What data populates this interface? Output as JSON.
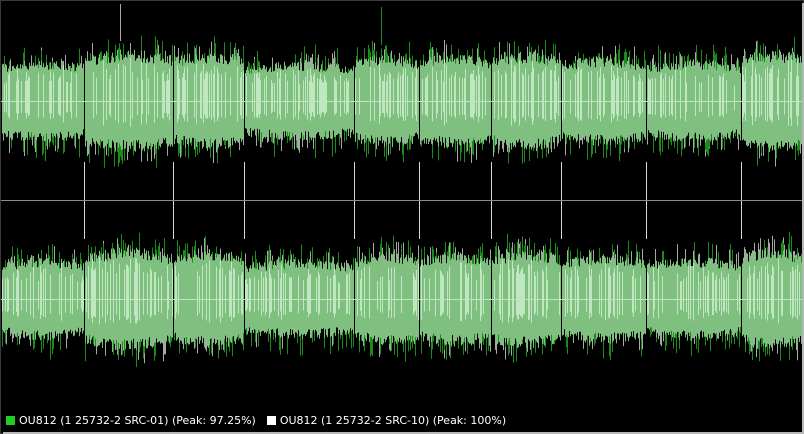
{
  "legend": {
    "items": [
      {
        "label": "OU812 (1 25732-2 SRC-01) (Peak: 97.25%)",
        "color": "#22cc22"
      },
      {
        "label": "OU812 (1 25732-2 SRC-10) (Peak: 100%)",
        "color": "#ffffff"
      }
    ]
  },
  "colors": {
    "background": "#000000",
    "wave_body": "#7fbf7f",
    "wave_highlight": "#c0e8c0",
    "wave_src01": "#1a8c1a",
    "wave_src10": "#a8a8a8",
    "center_line": "#c8e0c8",
    "channel_divider": "#8090a0",
    "track_marker": "#d8d8d8"
  }
}
